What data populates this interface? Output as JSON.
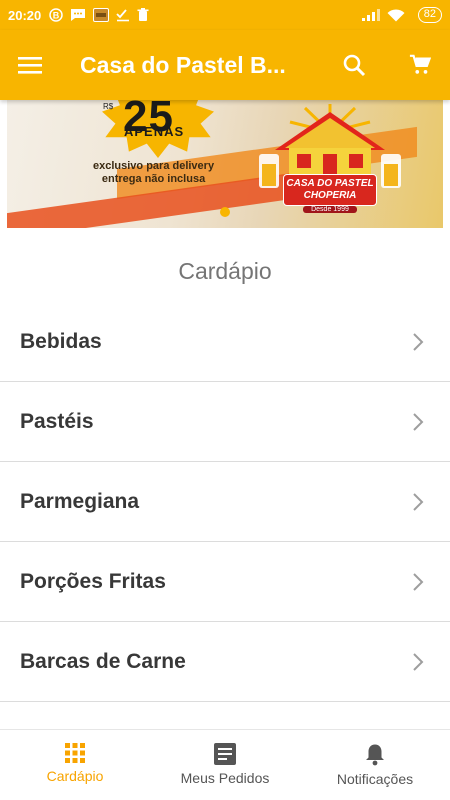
{
  "colors": {
    "brand": "#f8b500",
    "active": "#f8a400",
    "text_dark": "#383838",
    "text_muted": "#757575"
  },
  "status_bar": {
    "time": "20:20",
    "battery": "82"
  },
  "app_bar": {
    "title": "Casa do Pastel B...",
    "menu_icon": "hamburger-menu-icon",
    "search_icon": "search-icon",
    "cart_icon": "shopping-cart-icon"
  },
  "banner": {
    "currency": "R$",
    "price": "25",
    "apenas": "APENAS",
    "promo_line1": "exclusivo para delivery",
    "promo_line2": "entrega não inclusa",
    "logo_line1": "CASA DO PASTEL",
    "logo_line2": "CHOPERIA",
    "logo_since": "Desde 1999",
    "active_slide": 1,
    "slide_count": 1
  },
  "section": {
    "title": "Cardápio"
  },
  "menu": {
    "items": [
      {
        "label": "Bebidas"
      },
      {
        "label": "Pastéis"
      },
      {
        "label": "Parmegiana"
      },
      {
        "label": "Porções Fritas"
      },
      {
        "label": "Barcas de Carne"
      }
    ]
  },
  "bottom_nav": {
    "items": [
      {
        "label": "Cardápio",
        "icon": "grid-icon",
        "active": true
      },
      {
        "label": "Meus Pedidos",
        "icon": "receipt-icon",
        "active": false
      },
      {
        "label": "Notificações",
        "icon": "bell-icon",
        "active": false
      }
    ]
  }
}
